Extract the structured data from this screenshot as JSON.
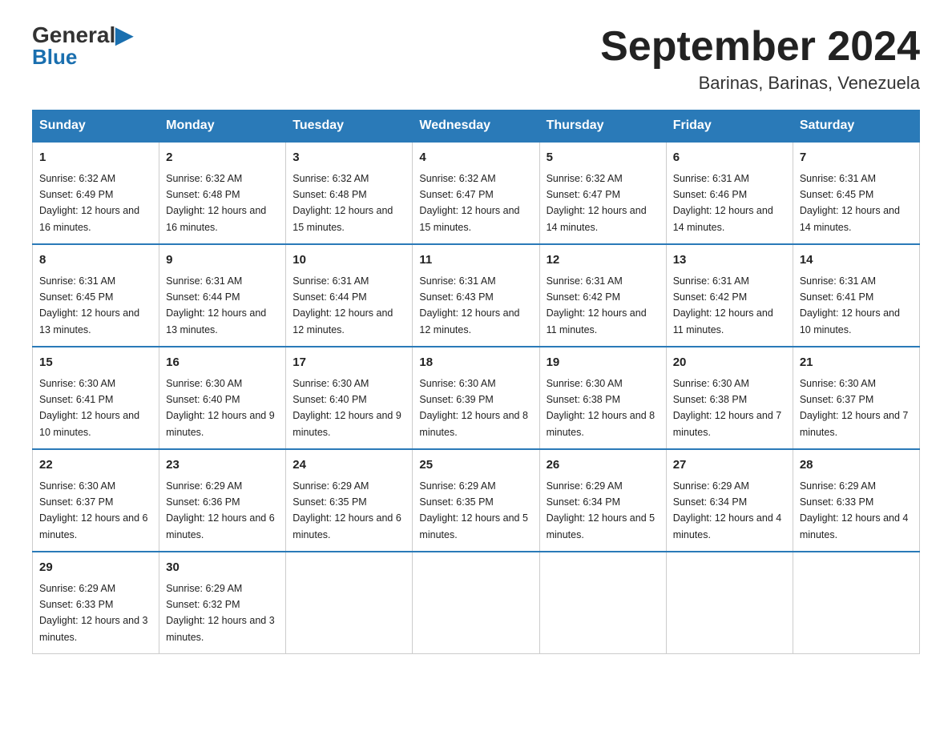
{
  "logo": {
    "general": "General",
    "blue": "Blue",
    "arrow_color": "#1a6faf"
  },
  "header": {
    "month_year": "September 2024",
    "location": "Barinas, Barinas, Venezuela"
  },
  "weekdays": [
    "Sunday",
    "Monday",
    "Tuesday",
    "Wednesday",
    "Thursday",
    "Friday",
    "Saturday"
  ],
  "weeks": [
    [
      {
        "day": "1",
        "sunrise": "6:32 AM",
        "sunset": "6:49 PM",
        "daylight": "12 hours and 16 minutes."
      },
      {
        "day": "2",
        "sunrise": "6:32 AM",
        "sunset": "6:48 PM",
        "daylight": "12 hours and 16 minutes."
      },
      {
        "day": "3",
        "sunrise": "6:32 AM",
        "sunset": "6:48 PM",
        "daylight": "12 hours and 15 minutes."
      },
      {
        "day": "4",
        "sunrise": "6:32 AM",
        "sunset": "6:47 PM",
        "daylight": "12 hours and 15 minutes."
      },
      {
        "day": "5",
        "sunrise": "6:32 AM",
        "sunset": "6:47 PM",
        "daylight": "12 hours and 14 minutes."
      },
      {
        "day": "6",
        "sunrise": "6:31 AM",
        "sunset": "6:46 PM",
        "daylight": "12 hours and 14 minutes."
      },
      {
        "day": "7",
        "sunrise": "6:31 AM",
        "sunset": "6:45 PM",
        "daylight": "12 hours and 14 minutes."
      }
    ],
    [
      {
        "day": "8",
        "sunrise": "6:31 AM",
        "sunset": "6:45 PM",
        "daylight": "12 hours and 13 minutes."
      },
      {
        "day": "9",
        "sunrise": "6:31 AM",
        "sunset": "6:44 PM",
        "daylight": "12 hours and 13 minutes."
      },
      {
        "day": "10",
        "sunrise": "6:31 AM",
        "sunset": "6:44 PM",
        "daylight": "12 hours and 12 minutes."
      },
      {
        "day": "11",
        "sunrise": "6:31 AM",
        "sunset": "6:43 PM",
        "daylight": "12 hours and 12 minutes."
      },
      {
        "day": "12",
        "sunrise": "6:31 AM",
        "sunset": "6:42 PM",
        "daylight": "12 hours and 11 minutes."
      },
      {
        "day": "13",
        "sunrise": "6:31 AM",
        "sunset": "6:42 PM",
        "daylight": "12 hours and 11 minutes."
      },
      {
        "day": "14",
        "sunrise": "6:31 AM",
        "sunset": "6:41 PM",
        "daylight": "12 hours and 10 minutes."
      }
    ],
    [
      {
        "day": "15",
        "sunrise": "6:30 AM",
        "sunset": "6:41 PM",
        "daylight": "12 hours and 10 minutes."
      },
      {
        "day": "16",
        "sunrise": "6:30 AM",
        "sunset": "6:40 PM",
        "daylight": "12 hours and 9 minutes."
      },
      {
        "day": "17",
        "sunrise": "6:30 AM",
        "sunset": "6:40 PM",
        "daylight": "12 hours and 9 minutes."
      },
      {
        "day": "18",
        "sunrise": "6:30 AM",
        "sunset": "6:39 PM",
        "daylight": "12 hours and 8 minutes."
      },
      {
        "day": "19",
        "sunrise": "6:30 AM",
        "sunset": "6:38 PM",
        "daylight": "12 hours and 8 minutes."
      },
      {
        "day": "20",
        "sunrise": "6:30 AM",
        "sunset": "6:38 PM",
        "daylight": "12 hours and 7 minutes."
      },
      {
        "day": "21",
        "sunrise": "6:30 AM",
        "sunset": "6:37 PM",
        "daylight": "12 hours and 7 minutes."
      }
    ],
    [
      {
        "day": "22",
        "sunrise": "6:30 AM",
        "sunset": "6:37 PM",
        "daylight": "12 hours and 6 minutes."
      },
      {
        "day": "23",
        "sunrise": "6:29 AM",
        "sunset": "6:36 PM",
        "daylight": "12 hours and 6 minutes."
      },
      {
        "day": "24",
        "sunrise": "6:29 AM",
        "sunset": "6:35 PM",
        "daylight": "12 hours and 6 minutes."
      },
      {
        "day": "25",
        "sunrise": "6:29 AM",
        "sunset": "6:35 PM",
        "daylight": "12 hours and 5 minutes."
      },
      {
        "day": "26",
        "sunrise": "6:29 AM",
        "sunset": "6:34 PM",
        "daylight": "12 hours and 5 minutes."
      },
      {
        "day": "27",
        "sunrise": "6:29 AM",
        "sunset": "6:34 PM",
        "daylight": "12 hours and 4 minutes."
      },
      {
        "day": "28",
        "sunrise": "6:29 AM",
        "sunset": "6:33 PM",
        "daylight": "12 hours and 4 minutes."
      }
    ],
    [
      {
        "day": "29",
        "sunrise": "6:29 AM",
        "sunset": "6:33 PM",
        "daylight": "12 hours and 3 minutes."
      },
      {
        "day": "30",
        "sunrise": "6:29 AM",
        "sunset": "6:32 PM",
        "daylight": "12 hours and 3 minutes."
      },
      null,
      null,
      null,
      null,
      null
    ]
  ],
  "labels": {
    "sunrise": "Sunrise:",
    "sunset": "Sunset:",
    "daylight": "Daylight:"
  }
}
